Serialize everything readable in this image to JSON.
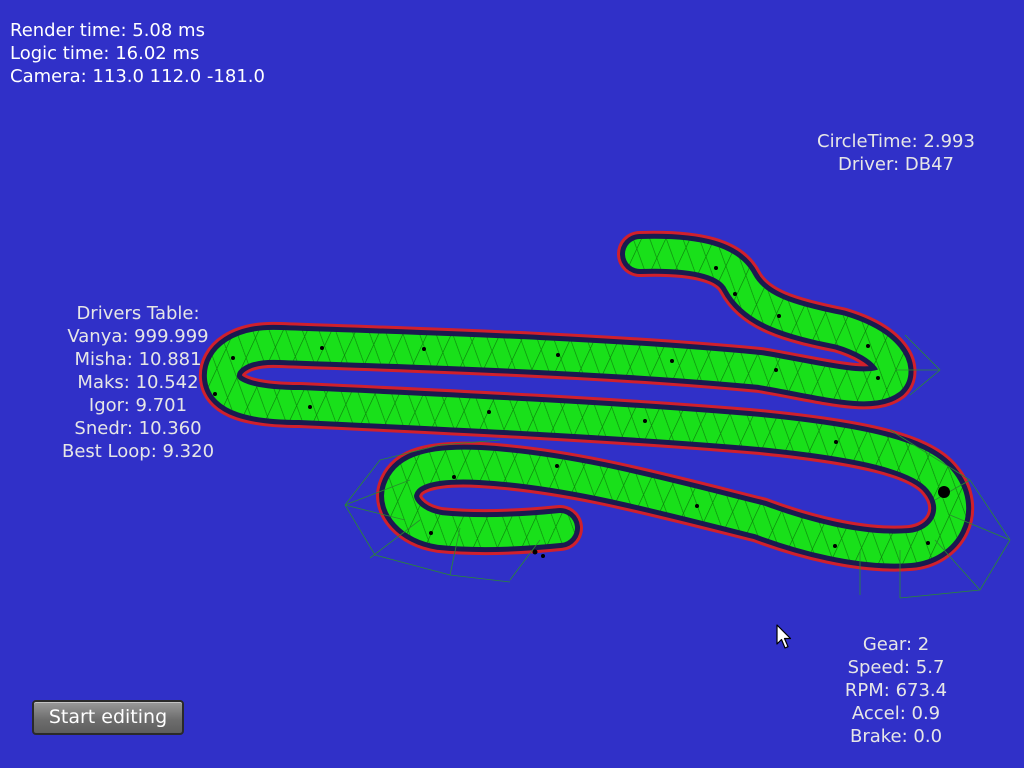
{
  "colors": {
    "background": "#3030c8",
    "track_fill": "#00ff00",
    "track_outer_edge": "#ff0000",
    "track_inner_edge": "#000000",
    "track_marker": "#000000"
  },
  "stats": {
    "render_time": "Render time: 5.08 ms",
    "logic_time": "Logic time: 16.02 ms",
    "camera": "Camera: 113.0 112.0 -181.0"
  },
  "lap_info": {
    "circle_time": "CircleTime: 2.993",
    "driver": "Driver: DB47"
  },
  "drivers_table": {
    "title": "Drivers Table:",
    "rows": [
      "Vanya: 999.999",
      "Misha: 10.881",
      "Maks: 10.542",
      "Igor: 9.701",
      "Snedr: 10.360"
    ],
    "best_loop": "Best Loop: 9.320"
  },
  "car": {
    "gear": "Gear: 2",
    "speed": "Speed: 5.7",
    "rpm": "RPM: 673.4",
    "accel": "Accel: 0.9",
    "brake": "Brake: 0.0"
  },
  "controls": {
    "start_editing_label": "Start editing"
  },
  "icons": {
    "cursor": "mouse-pointer-icon"
  }
}
